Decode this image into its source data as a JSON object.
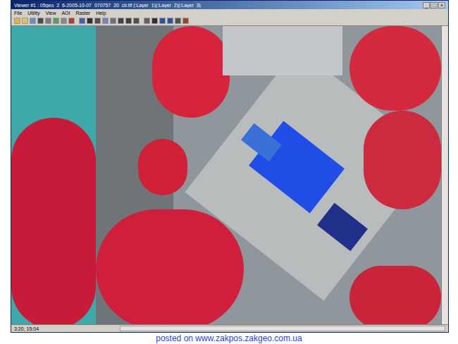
{
  "window": {
    "title": "Viewer #1 : 05geo_2_6-2005-10-07_070757_20_clr.tif (:Layer_1)(:Layer_2)(:Layer_3)",
    "controls": [
      "_",
      "□",
      "×"
    ]
  },
  "menu": [
    "File",
    "Utility",
    "View",
    "AOI",
    "Raster",
    "Help"
  ],
  "status_bar": {
    "coords": "3:20, 15:04"
  },
  "caption": "posted on www.zakpos.zakgeo.com.ua"
}
